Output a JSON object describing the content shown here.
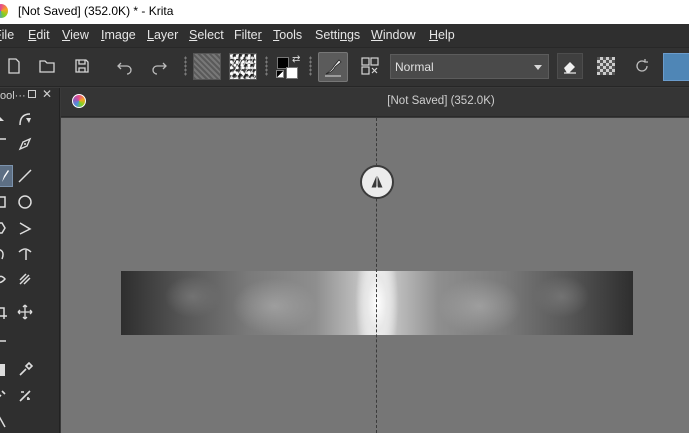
{
  "window": {
    "title": "[Not Saved]  (352.0K) * - Krita"
  },
  "menubar": {
    "items": [
      {
        "label": "File",
        "underline": "F"
      },
      {
        "label": "Edit",
        "underline": "E"
      },
      {
        "label": "View",
        "underline": "V"
      },
      {
        "label": "Image",
        "underline": "I"
      },
      {
        "label": "Layer",
        "underline": "L"
      },
      {
        "label": "Select",
        "underline": "S"
      },
      {
        "label": "Filter",
        "underline": "r"
      },
      {
        "label": "Tools",
        "underline": "T"
      },
      {
        "label": "Settings",
        "underline": "n"
      },
      {
        "label": "Window",
        "underline": "W"
      },
      {
        "label": "Help",
        "underline": "H"
      }
    ]
  },
  "toolbar": {
    "blend_mode": "Normal"
  },
  "toolbox": {
    "title": "ool···"
  },
  "document": {
    "title": "[Not Saved]  (352.0K)"
  },
  "colors": {
    "foreground": "#000000",
    "background": "#ffffff",
    "canvas_bg": "#767676",
    "accent": "#4f86b6"
  }
}
